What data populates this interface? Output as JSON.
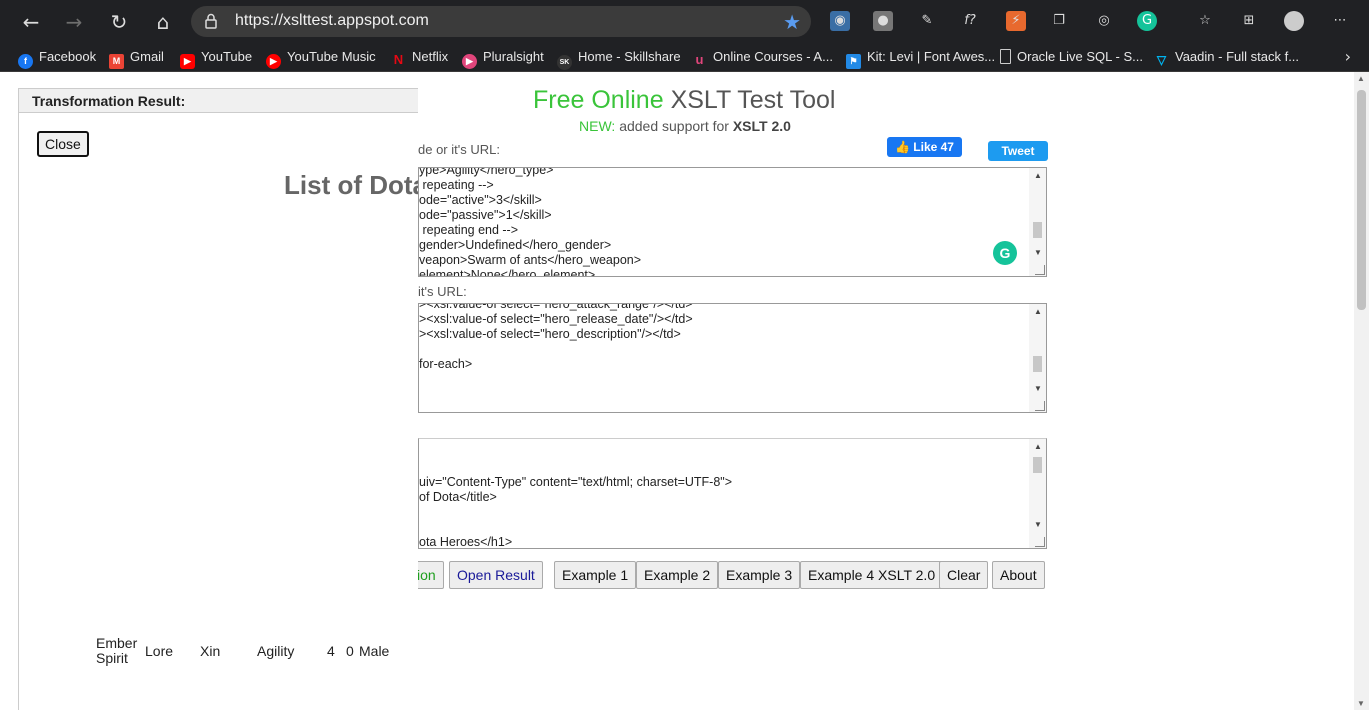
{
  "browser": {
    "url": "https://xslttest.appspot.com",
    "bookmarks": [
      {
        "label": "Facebook",
        "color": "#1877f2"
      },
      {
        "label": "Gmail",
        "color": "#ea4335"
      },
      {
        "label": "YouTube",
        "color": "#ff0000"
      },
      {
        "label": "YouTube Music",
        "color": "#ff0000"
      },
      {
        "label": "Netflix",
        "color": "#e50914"
      },
      {
        "label": "Pluralsight",
        "color": "#f15b2a"
      },
      {
        "label": "Home - Skillshare",
        "color": "#111111"
      },
      {
        "label": "Online Courses - A...",
        "color": "#a435f0"
      },
      {
        "label": "Kit: Levi | Font Awes...",
        "color": "#228ae6"
      },
      {
        "label": "Oracle Live SQL - S...",
        "color": "#cccccc"
      },
      {
        "label": "Vaadin - Full stack f...",
        "color": "#00b4f0"
      }
    ]
  },
  "result": {
    "header": "Transformation Result:",
    "close_label": "Close",
    "title": "List of Dota",
    "row": {
      "name_line1": "Ember",
      "name_line2": "Spirit",
      "col2": "Lore",
      "col3": "Xin",
      "col4": "Agility",
      "col5": "4",
      "col6": "0",
      "col7": "Male"
    }
  },
  "tool": {
    "title_green": "Free Online",
    "title_rest": " XSLT Test Tool",
    "subtitle_new": "NEW:",
    "subtitle_text": " added support for ",
    "subtitle_bold": "XSLT 2.0",
    "xml_label": "de or it's URL:",
    "xsl_label": " it's URL:",
    "fb_like": "Like 47",
    "tweet": "Tweet",
    "xml_lines": [
      "ype>Agility</hero_type>",
      " repeating -->",
      "ode=\"active\">3</skill>",
      "ode=\"passive\">1</skill>",
      " repeating end -->",
      "gender>Undefined</hero_gender>",
      "veapon>Swarm of ants</hero_weapon>",
      "element>None</hero_element>"
    ],
    "xsl_lines": [
      "><xsl:value-of select=\"hero_attack_range\"/></td>",
      "><xsl:value-of select=\"hero_release_date\"/></td>",
      "><xsl:value-of select=\"hero_description\"/></td>",
      "",
      "for-each>"
    ],
    "out_lines": [
      "",
      "",
      "uiv=\"Content-Type\" content=\"text/html; charset=UTF-8\">",
      "of Dota</title>",
      "",
      "",
      "ota Heroes</h1>"
    ],
    "buttons": {
      "transform": "ion",
      "open_result": "Open Result",
      "example1": "Example 1",
      "example2": "Example 2",
      "example3": "Example 3",
      "example4": "Example 4 XSLT 2.0",
      "clear": "Clear",
      "about": "About"
    }
  }
}
